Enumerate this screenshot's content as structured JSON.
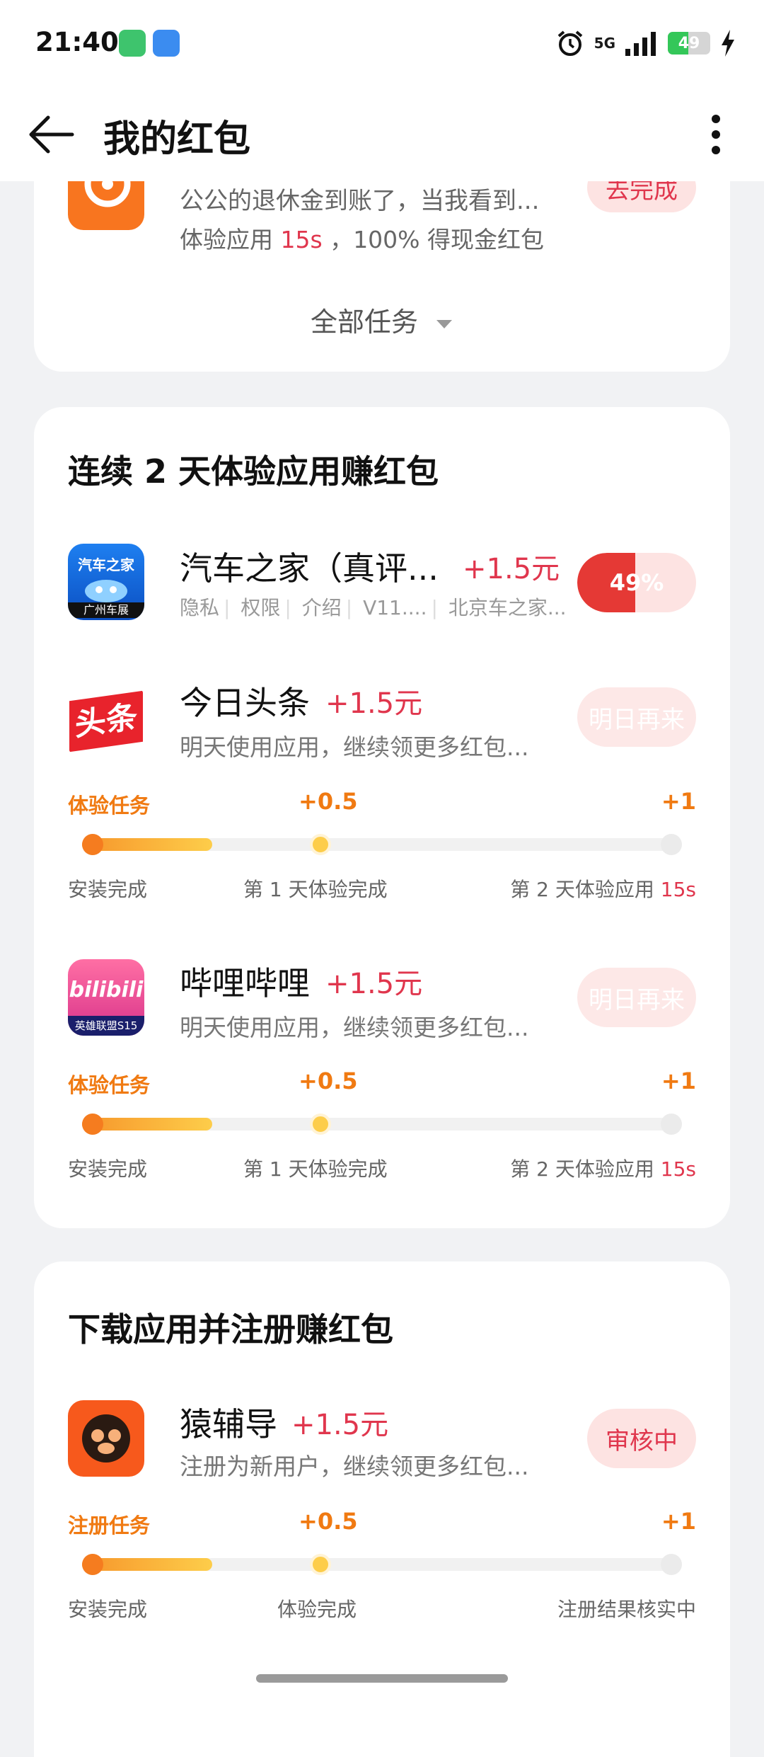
{
  "status_bar": {
    "time": "21:40",
    "network": "5G",
    "battery": "49",
    "battery_level": 0.49
  },
  "nav": {
    "title": "我的红包"
  },
  "top_card": {
    "desc": "公公的退休金到账了，当我看到...",
    "hint_prefix": "体验应用",
    "hint_time": "15s",
    "hint_suffix": "，100% 得现金红包",
    "button": "去完成",
    "all_tasks": "全部任务"
  },
  "section_continuous": {
    "title": "连续 2 天体验应用赚红包",
    "apps": [
      {
        "name": "汽车之家（真评...",
        "reward": "+1.5元",
        "meta": [
          "隐私",
          "权限",
          "介绍",
          "V11....",
          "北京车之家..."
        ],
        "progress_label": "49%",
        "progress": 0.49,
        "icon_text": "汽车之家",
        "icon_sub": "广州车展"
      },
      {
        "name": "今日头条",
        "reward": "+1.5元",
        "desc": "明天使用应用，继续领更多红包...",
        "button": "明日再来",
        "icon_text": "头条",
        "task_label": "体验任务",
        "task_mid": "+0.5",
        "task_end": "+1",
        "progress": 0.5,
        "steps": [
          "安装完成",
          "第 1 天体验完成",
          "第 2 天体验应用"
        ],
        "step_time": "15s"
      },
      {
        "name": "哔哩哔哩",
        "reward": "+1.5元",
        "desc": "明天使用应用，继续领更多红包...",
        "button": "明日再来",
        "icon_text": "bilibili",
        "icon_sub": "英雄联盟S15",
        "task_label": "体验任务",
        "task_mid": "+0.5",
        "task_end": "+1",
        "progress": 0.5,
        "steps": [
          "安装完成",
          "第 1 天体验完成",
          "第 2 天体验应用"
        ],
        "step_time": "15s"
      }
    ]
  },
  "section_register": {
    "title": "下载应用并注册赚红包",
    "app": {
      "name": "猿辅导",
      "reward": "+1.5元",
      "desc": "注册为新用户，继续领更多红包...",
      "button": "审核中",
      "task_label": "注册任务",
      "task_mid": "+0.5",
      "task_end": "+1",
      "progress": 0.5,
      "steps": [
        "安装完成",
        "体验完成",
        "注册结果核实中"
      ]
    }
  },
  "colors": {
    "accent_red": "#e0364d",
    "orange": "#f07a12",
    "pill_bg": "#fde3e2"
  }
}
